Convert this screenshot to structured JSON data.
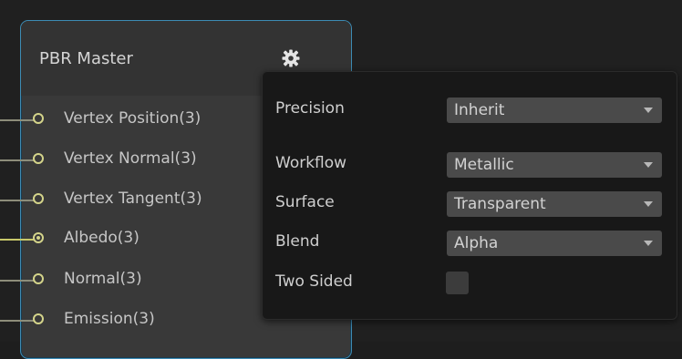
{
  "node": {
    "title": "PBR Master",
    "settings_icon": "gear-icon",
    "ports": [
      {
        "label": "Vertex Position(3)",
        "connected": true,
        "active": false
      },
      {
        "label": "Vertex Normal(3)",
        "connected": true,
        "active": false
      },
      {
        "label": "Vertex Tangent(3)",
        "connected": true,
        "active": false
      },
      {
        "label": "Albedo(3)",
        "connected": true,
        "active": true
      },
      {
        "label": "Normal(3)",
        "connected": true,
        "active": false
      },
      {
        "label": "Emission(3)",
        "connected": true,
        "active": false
      }
    ]
  },
  "settings": {
    "precision": {
      "label": "Precision",
      "value": "Inherit"
    },
    "workflow": {
      "label": "Workflow",
      "value": "Metallic"
    },
    "surface": {
      "label": "Surface",
      "value": "Transparent"
    },
    "blend": {
      "label": "Blend",
      "value": "Alpha"
    },
    "two_sided": {
      "label": "Two Sided",
      "checked": false
    }
  },
  "colors": {
    "node_border": "#3d8bb4",
    "port": "#d4d48a",
    "popup_bg": "#181818",
    "dropdown_bg": "#4a4a4a"
  }
}
